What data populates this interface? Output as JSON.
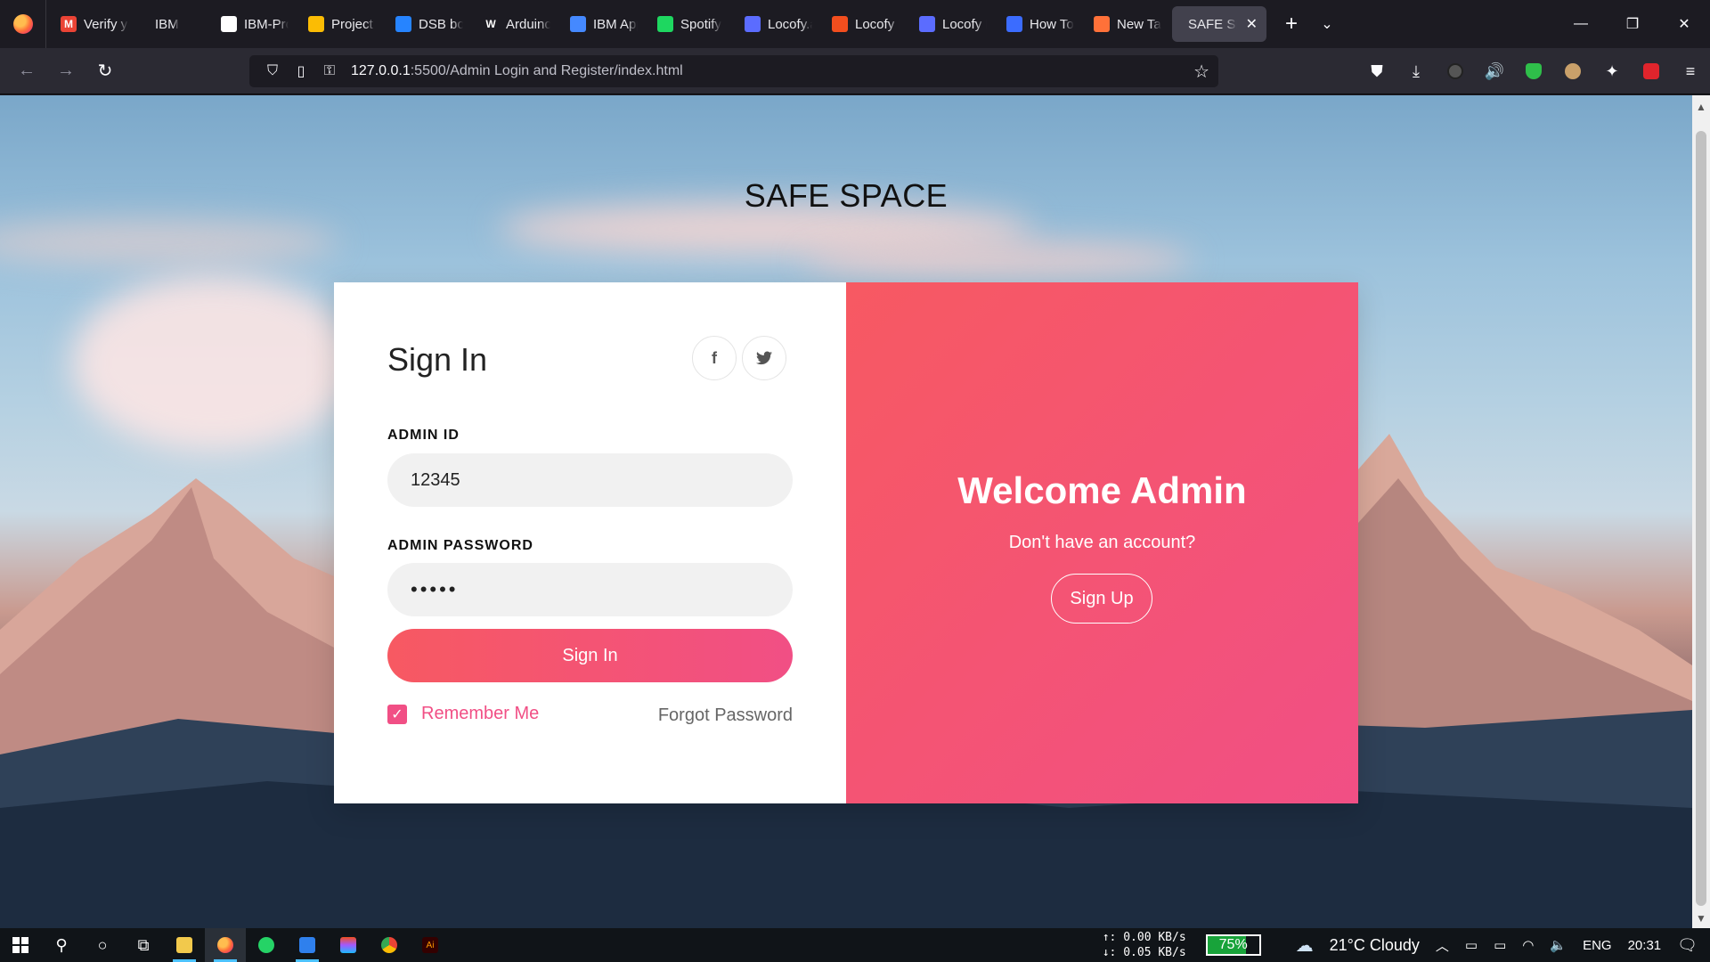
{
  "browser": {
    "tabs": [
      {
        "title": "Verify yo",
        "icon": "gmail-icon",
        "color": "#ea4335",
        "glyph": "M"
      },
      {
        "title": "IBM",
        "icon": "blank-icon",
        "color": "#1c1b22",
        "glyph": ""
      },
      {
        "title": "IBM-Pro",
        "icon": "github-icon",
        "color": "#ffffff",
        "glyph": ""
      },
      {
        "title": "Project T",
        "icon": "drive-icon",
        "color": "#fbbc04",
        "glyph": ""
      },
      {
        "title": "DSB boa",
        "icon": "jira-icon",
        "color": "#2684ff",
        "glyph": ""
      },
      {
        "title": "Arduino",
        "icon": "wix-icon",
        "color": "#1c1b22",
        "glyph": "W"
      },
      {
        "title": "IBM App",
        "icon": "ibm-cloud-icon",
        "color": "#4589ff",
        "glyph": ""
      },
      {
        "title": "Spotify",
        "icon": "spotify-icon",
        "color": "#1ed760",
        "glyph": ""
      },
      {
        "title": "Locofy.a",
        "icon": "locofy-icon",
        "color": "#5b6cff",
        "glyph": ""
      },
      {
        "title": "Locofy F",
        "icon": "figma-icon",
        "color": "#f24e1e",
        "glyph": ""
      },
      {
        "title": "Locofy B",
        "icon": "locofy-icon",
        "color": "#5b6cff",
        "glyph": ""
      },
      {
        "title": "How To",
        "icon": "compass-icon",
        "color": "#3b6cff",
        "glyph": ""
      },
      {
        "title": "New Tab",
        "icon": "firefox-icon",
        "color": "#ff7139",
        "glyph": ""
      },
      {
        "title": "SAFE SPAC",
        "icon": "blank-icon",
        "color": "#42414d",
        "glyph": "",
        "active": true
      }
    ],
    "url_host": "127.0.0.1",
    "url_rest": ":5500/Admin Login and Register/index.html"
  },
  "page": {
    "site_title": "SAFE SPACE",
    "signin_title": "Sign In",
    "social": {
      "facebook": "f",
      "twitter": "🐦"
    },
    "admin_id_label": "ADMIN ID",
    "admin_id_value": "12345",
    "admin_password_label": "ADMIN PASSWORD",
    "admin_password_value": "•••••",
    "signin_button": "Sign In",
    "remember_label": "Remember Me",
    "remember_checked": true,
    "forgot_label": "Forgot Password",
    "welcome_title": "Welcome Admin",
    "no_account_text": "Don't have an account?",
    "signup_button": "Sign Up",
    "accent_color": "#f14f85",
    "accent_color_start": "#f75962"
  },
  "taskbar": {
    "net_up": "↑: 0.00 KB/s",
    "net_down": "↓: 0.05 KB/s",
    "battery": "75%",
    "battery_level": 0.75,
    "weather": "21°C  Cloudy",
    "language": "ENG",
    "time": "20:31"
  }
}
